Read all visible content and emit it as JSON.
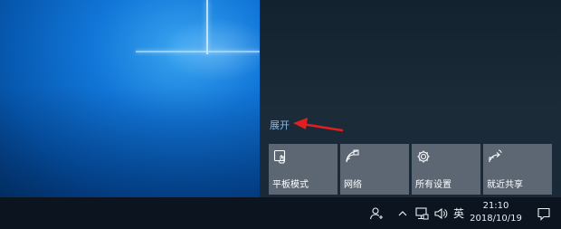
{
  "action_center": {
    "expand_label": "展开",
    "tiles": [
      {
        "label": "平板模式",
        "icon": "tablet-mode-icon"
      },
      {
        "label": "网络",
        "icon": "network-icon"
      },
      {
        "label": "所有设置",
        "icon": "settings-gear-icon"
      },
      {
        "label": "就近共享",
        "icon": "nearby-share-icon"
      }
    ]
  },
  "taskbar": {
    "ime_label": "英",
    "time": "21:10",
    "date": "2018/10/19"
  },
  "colors": {
    "tile_bg": "#5d6773",
    "link": "#8ab8e6",
    "arrow": "#e02020"
  }
}
